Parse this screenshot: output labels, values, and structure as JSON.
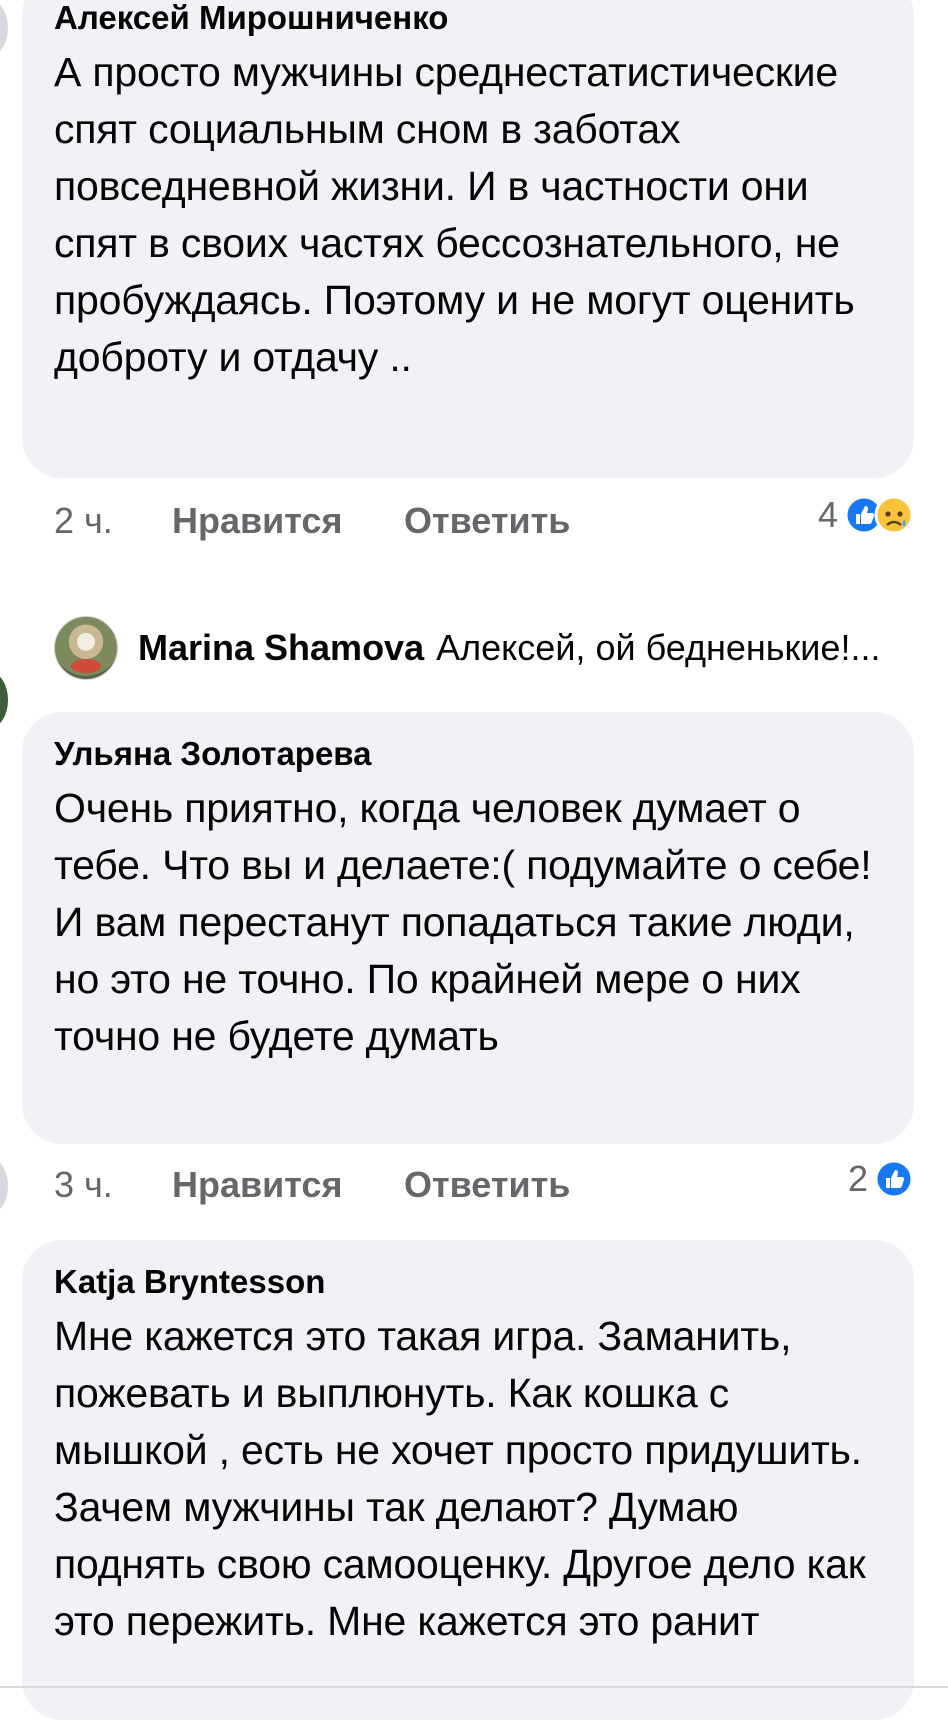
{
  "comments": [
    {
      "author": "Алексей Мирошниченко",
      "text": "А просто мужчины среднестатистические спят социальным сном в заботах повседневной жизни. И в частности они спят в своих частях бессознательного, не пробуждаясь. Поэтому и не могут оценить доброту и отдачу ..",
      "time": "2 ч.",
      "like_label": "Нравится",
      "reply_label": "Ответить",
      "reaction_count": "4",
      "reactions": [
        "like-icon",
        "sad-icon"
      ]
    },
    {
      "author": "Ульяна Золотарева",
      "text": "Очень приятно, когда человек думает о тебе. Что вы и делаете:( подумайте о себе! И вам перестанут попадаться такие люди, но это не точно. По крайней мере о них точно не будете думать",
      "time": "3 ч.",
      "like_label": "Нравится",
      "reply_label": "Ответить",
      "reaction_count": "2",
      "reactions": [
        "like-icon"
      ]
    },
    {
      "author": "Katja Bryntesson",
      "text": "Мне кажется это такая игра. Заманить, пожевать и выплюнуть. Как кошка с мышкой , есть не хочет просто придушить. Зачем мужчины так делают? Думаю поднять свою самооценку. Другое дело как это пережить. Мне кажется это ранит"
    }
  ],
  "reply_preview": {
    "author": "Marina Shamova",
    "text": "Алексей, ой бедненькие!..."
  },
  "colors": {
    "bubble": "#f0f2f5",
    "meta": "#65676b",
    "like_blue": "#1877f2",
    "sad_yellow": "#f7c33b"
  }
}
